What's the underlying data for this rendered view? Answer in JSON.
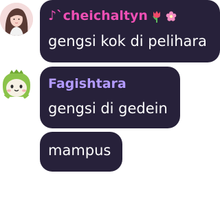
{
  "messages": [
    {
      "sender": "♪`cheichaltyn",
      "sender_color": "#ee4fb4",
      "name_decorations": [
        "tulip-icon",
        "blossom-icon"
      ],
      "text": "gengsi kok di pelihara"
    },
    {
      "sender": "Fagishtara",
      "sender_color": "#b39bff",
      "text": "gengsi di gedein"
    },
    {
      "text": "mampus"
    }
  ],
  "colors": {
    "bubble": "#27213a",
    "background": "#ffffff"
  }
}
